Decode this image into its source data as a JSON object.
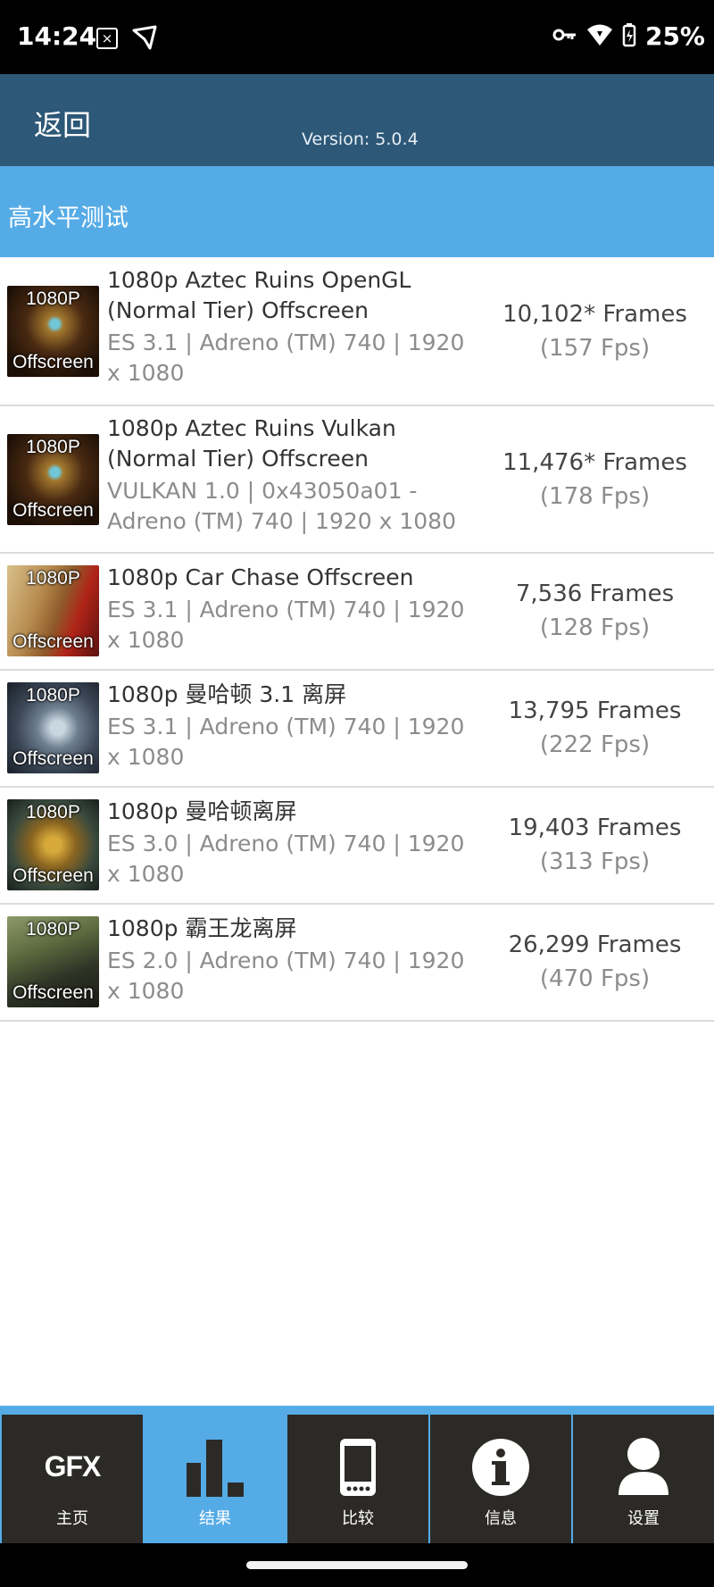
{
  "status_bar": {
    "time": "14:24",
    "battery": "25%"
  },
  "header": {
    "back_label": "返回",
    "version": "Version: 5.0.4"
  },
  "section": {
    "title": "高水平测试"
  },
  "tests": [
    {
      "thumb_top": "1080P",
      "thumb_bottom": "Offscreen",
      "name": "1080p Aztec Ruins OpenGL (Normal Tier) Offscreen",
      "desc": "ES 3.1 | Adreno (TM) 740 | 1920 x 1080",
      "frames": "10,102* Frames",
      "fps": "(157 Fps)"
    },
    {
      "thumb_top": "1080P",
      "thumb_bottom": "Offscreen",
      "name": "1080p Aztec Ruins Vulkan (Normal Tier) Offscreen",
      "desc": "VULKAN 1.0 | 0x43050a01 - Adreno (TM) 740 | 1920 x 1080",
      "frames": "11,476* Frames",
      "fps": "(178 Fps)"
    },
    {
      "thumb_top": "1080P",
      "thumb_bottom": "Offscreen",
      "name": "1080p Car Chase Offscreen",
      "desc": "ES 3.1 | Adreno (TM) 740 | 1920 x 1080",
      "frames": "7,536 Frames",
      "fps": "(128 Fps)"
    },
    {
      "thumb_top": "1080P",
      "thumb_bottom": "Offscreen",
      "name": "1080p 曼哈顿 3.1 离屏",
      "desc": "ES 3.1 | Adreno (TM) 740 | 1920 x 1080",
      "frames": "13,795 Frames",
      "fps": "(222 Fps)"
    },
    {
      "thumb_top": "1080P",
      "thumb_bottom": "Offscreen",
      "name": "1080p 曼哈顿离屏",
      "desc": "ES 3.0 | Adreno (TM) 740 | 1920 x 1080",
      "frames": "19,403 Frames",
      "fps": "(313 Fps)"
    },
    {
      "thumb_top": "1080P",
      "thumb_bottom": "Offscreen",
      "name": "1080p 霸王龙离屏",
      "desc": "ES 2.0 | Adreno (TM) 740 | 1920 x 1080",
      "frames": "26,299 Frames",
      "fps": "(470 Fps)"
    }
  ],
  "tabs": [
    {
      "label": "主页",
      "icon_text": "GFX",
      "icon": "gfx-logo-icon"
    },
    {
      "label": "结果",
      "icon": "bar-chart-icon",
      "active": true
    },
    {
      "label": "比较",
      "icon": "phone-icon"
    },
    {
      "label": "信息",
      "icon": "info-icon"
    },
    {
      "label": "设置",
      "icon": "user-icon"
    }
  ],
  "colors": {
    "status_bar": "#000000",
    "header": "#2d5877",
    "accent": "#55abe6",
    "tab_bg": "#2c2a27"
  }
}
